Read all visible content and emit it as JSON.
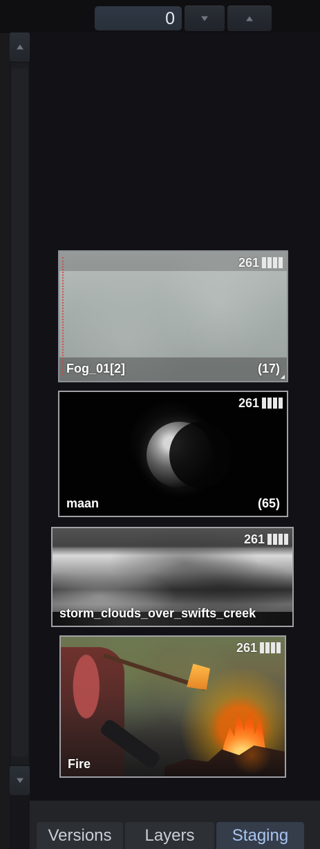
{
  "toolbar": {
    "counter_value": "0"
  },
  "staging": {
    "items": [
      {
        "name": "Fog_01[2]",
        "frames": "(17)",
        "count": "261"
      },
      {
        "name": "maan",
        "frames": "(65)",
        "count": "261"
      },
      {
        "name": "storm_clouds_over_swifts_creek",
        "frames": "",
        "count": "261"
      },
      {
        "name": "Fire",
        "frames": "",
        "count": "261"
      }
    ]
  },
  "tabs": [
    {
      "label": "Versions"
    },
    {
      "label": "Layers"
    },
    {
      "label": "Staging",
      "active": true
    }
  ],
  "colors": {
    "background": "#121216",
    "panel": "#232427",
    "tab_inactive": "#2d3035",
    "tab_active": "#353d4b",
    "tab_active_text": "#a8c5ef",
    "counter_bg": "#2f3844"
  },
  "icons": {
    "spin_down": "triangle-down",
    "spin_up": "triangle-up",
    "scroll_up": "triangle-up",
    "scroll_down": "triangle-down",
    "card_meter": "bars"
  }
}
